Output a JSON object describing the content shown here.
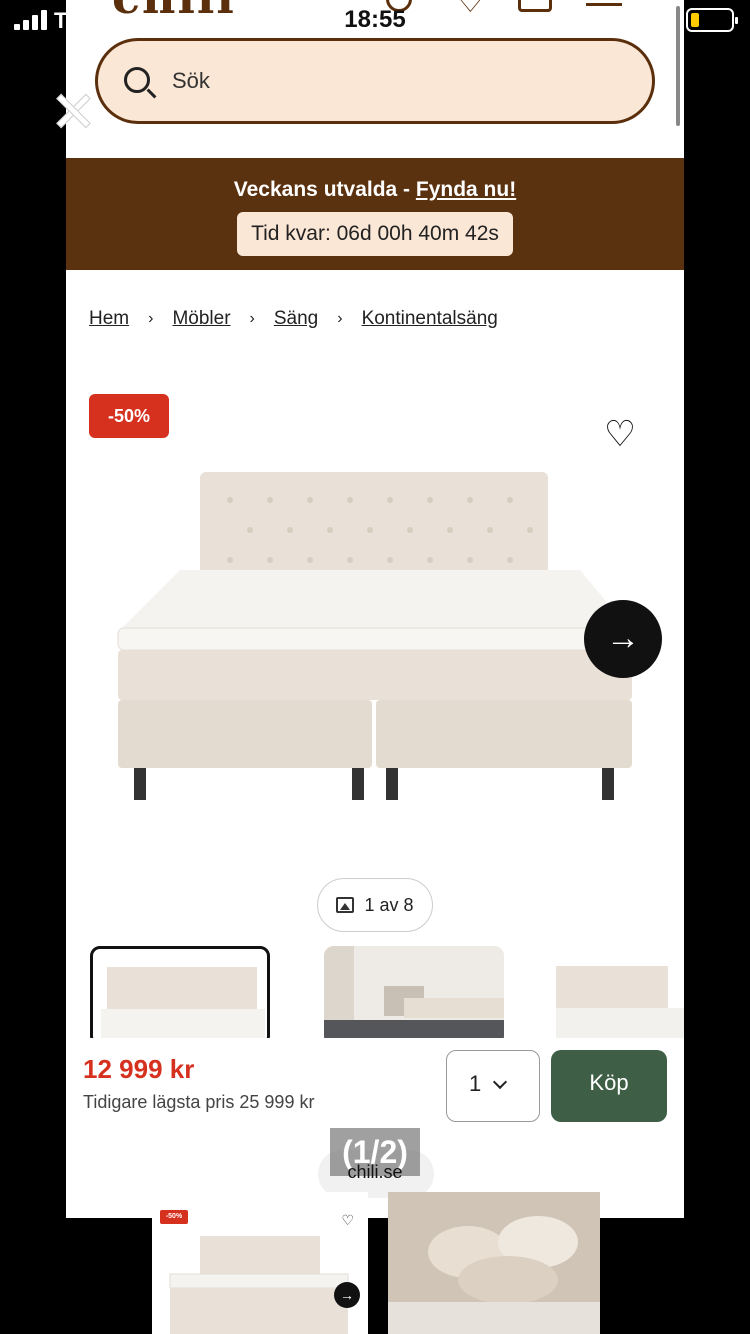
{
  "status_bar": {
    "carrier": "T",
    "time": "18:55"
  },
  "site": {
    "logo": "chili",
    "search_placeholder": "Sök"
  },
  "promo": {
    "text": "Veckans utvalda - ",
    "link": "Fynda nu!",
    "countdown": "Tid kvar: 06d 00h 40m 42s"
  },
  "breadcrumb": [
    "Hem",
    "Möbler",
    "Säng",
    "Kontinentalsäng"
  ],
  "product": {
    "discount": "-50%",
    "image_counter": "1 av 8",
    "price": "12 999 kr",
    "prior_price": "Tidigare lägsta pris 25 999 kr",
    "quantity": "1",
    "buy_label": "Köp"
  },
  "overlay": {
    "pager": "(1/2)",
    "site": "chili.se"
  },
  "bottom_thumb": {
    "discount": "-50%"
  },
  "colors": {
    "brand_brown": "#5b3210",
    "sale_red": "#d6301f",
    "buy_green": "#3e5f46",
    "cream": "#fbe7d6"
  }
}
